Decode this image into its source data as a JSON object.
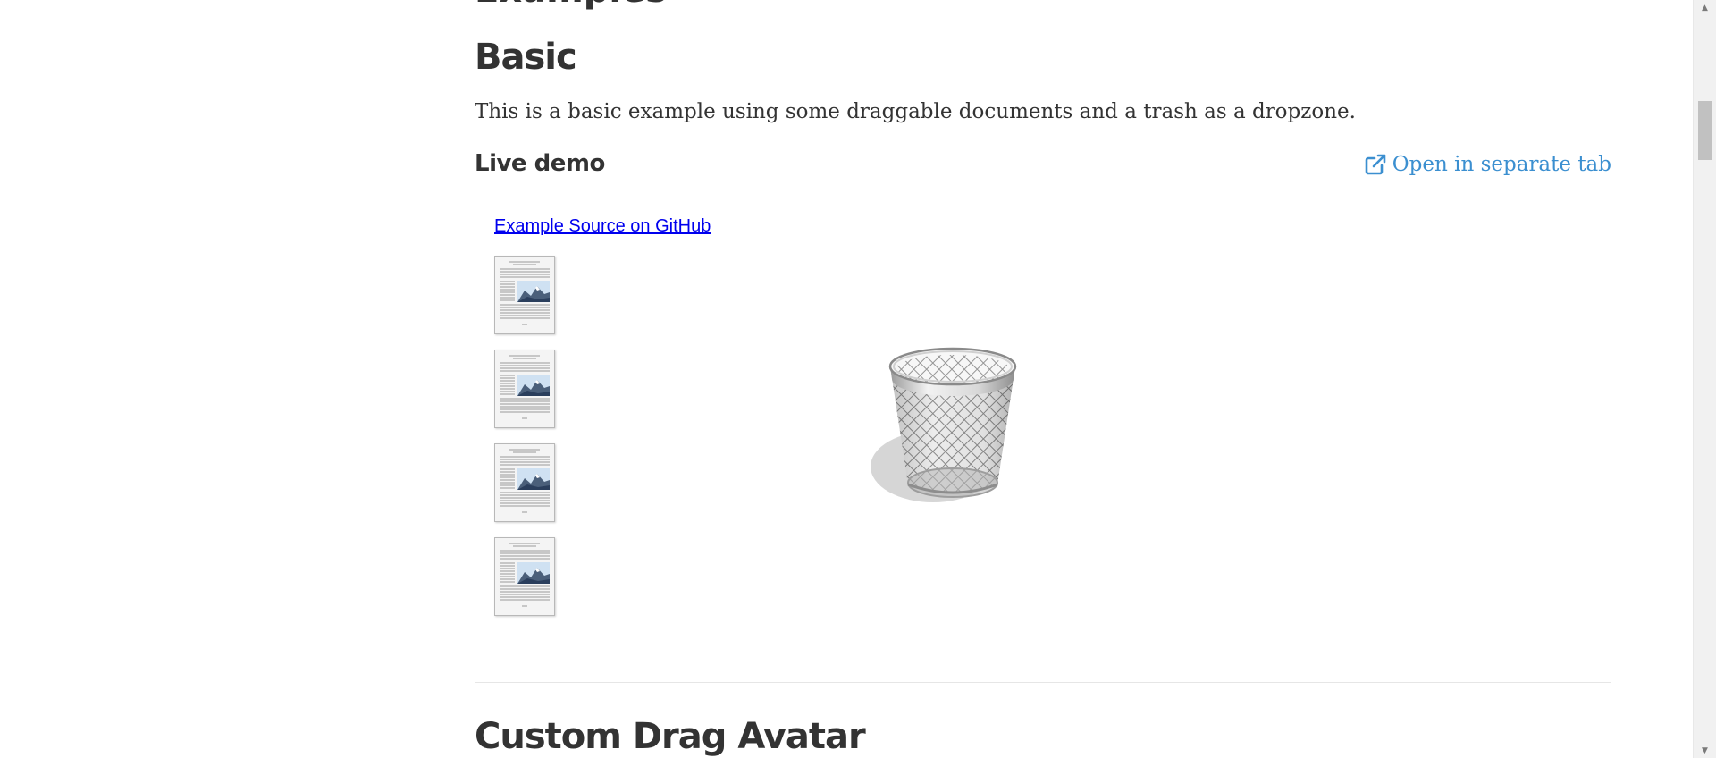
{
  "page": {
    "cut_heading": "Examples"
  },
  "section": {
    "title": "Basic",
    "description": "This is a basic example using some draggable documents and a trash as a dropzone.",
    "live_demo_label": "Live demo",
    "open_tab_label": "Open in separate tab",
    "open_tab_icon": "external-link-icon",
    "link_color": "#3b8fd0"
  },
  "demo": {
    "github_link": "Example Source on GitHub",
    "documents": [
      {
        "icon": "document-thumbnail"
      },
      {
        "icon": "document-thumbnail"
      },
      {
        "icon": "document-thumbnail"
      },
      {
        "icon": "document-thumbnail"
      }
    ],
    "trash_icon": "trash-can-icon"
  },
  "next_section": {
    "title": "Custom Drag Avatar"
  },
  "scrollbar": {
    "up_icon": "scroll-up-arrow",
    "down_icon": "scroll-down-arrow"
  }
}
